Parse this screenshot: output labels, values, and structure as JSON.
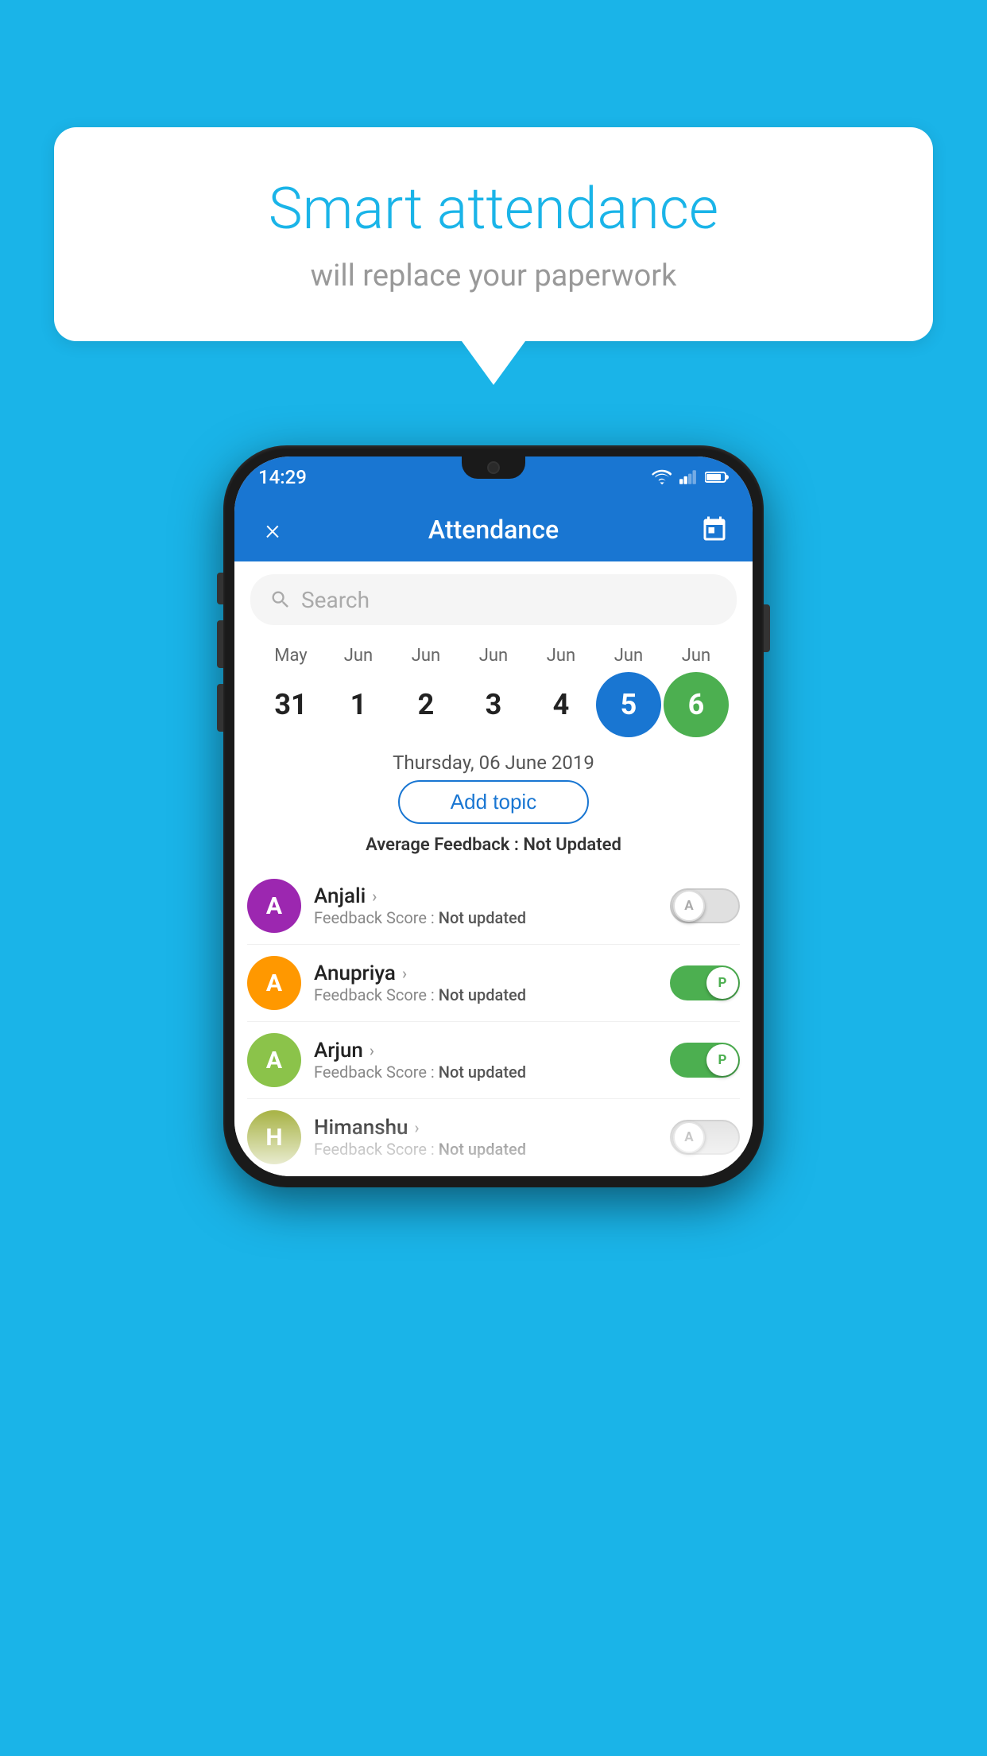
{
  "background_color": "#1ab4e8",
  "bubble": {
    "title": "Smart attendance",
    "subtitle": "will replace your paperwork"
  },
  "status_bar": {
    "time": "14:29"
  },
  "app_bar": {
    "title": "Attendance",
    "close_label": "×",
    "calendar_icon": "📅"
  },
  "search": {
    "placeholder": "Search"
  },
  "calendar": {
    "months": [
      "May",
      "Jun",
      "Jun",
      "Jun",
      "Jun",
      "Jun",
      "Jun"
    ],
    "dates": [
      "31",
      "1",
      "2",
      "3",
      "4",
      "5",
      "6"
    ],
    "selected_index": 5,
    "today_index": 6,
    "selected_date_label": "Thursday, 06 June 2019"
  },
  "add_topic": {
    "label": "Add topic"
  },
  "avg_feedback": {
    "label": "Average Feedback : ",
    "value": "Not Updated"
  },
  "students": [
    {
      "name": "Anjali",
      "avatar_letter": "A",
      "avatar_color": "#9c27b0",
      "feedback": "Feedback Score : Not updated",
      "attendance": "A",
      "present": false
    },
    {
      "name": "Anupriya",
      "avatar_letter": "A",
      "avatar_color": "#ff9800",
      "feedback": "Feedback Score : Not updated",
      "attendance": "P",
      "present": true
    },
    {
      "name": "Arjun",
      "avatar_letter": "A",
      "avatar_color": "#8bc34a",
      "feedback": "Feedback Score : Not updated",
      "attendance": "P",
      "present": true
    },
    {
      "name": "Himanshu",
      "avatar_letter": "H",
      "avatar_color": "#aab54a",
      "feedback": "Feedback Score : Not updated",
      "attendance": "A",
      "present": false
    }
  ]
}
